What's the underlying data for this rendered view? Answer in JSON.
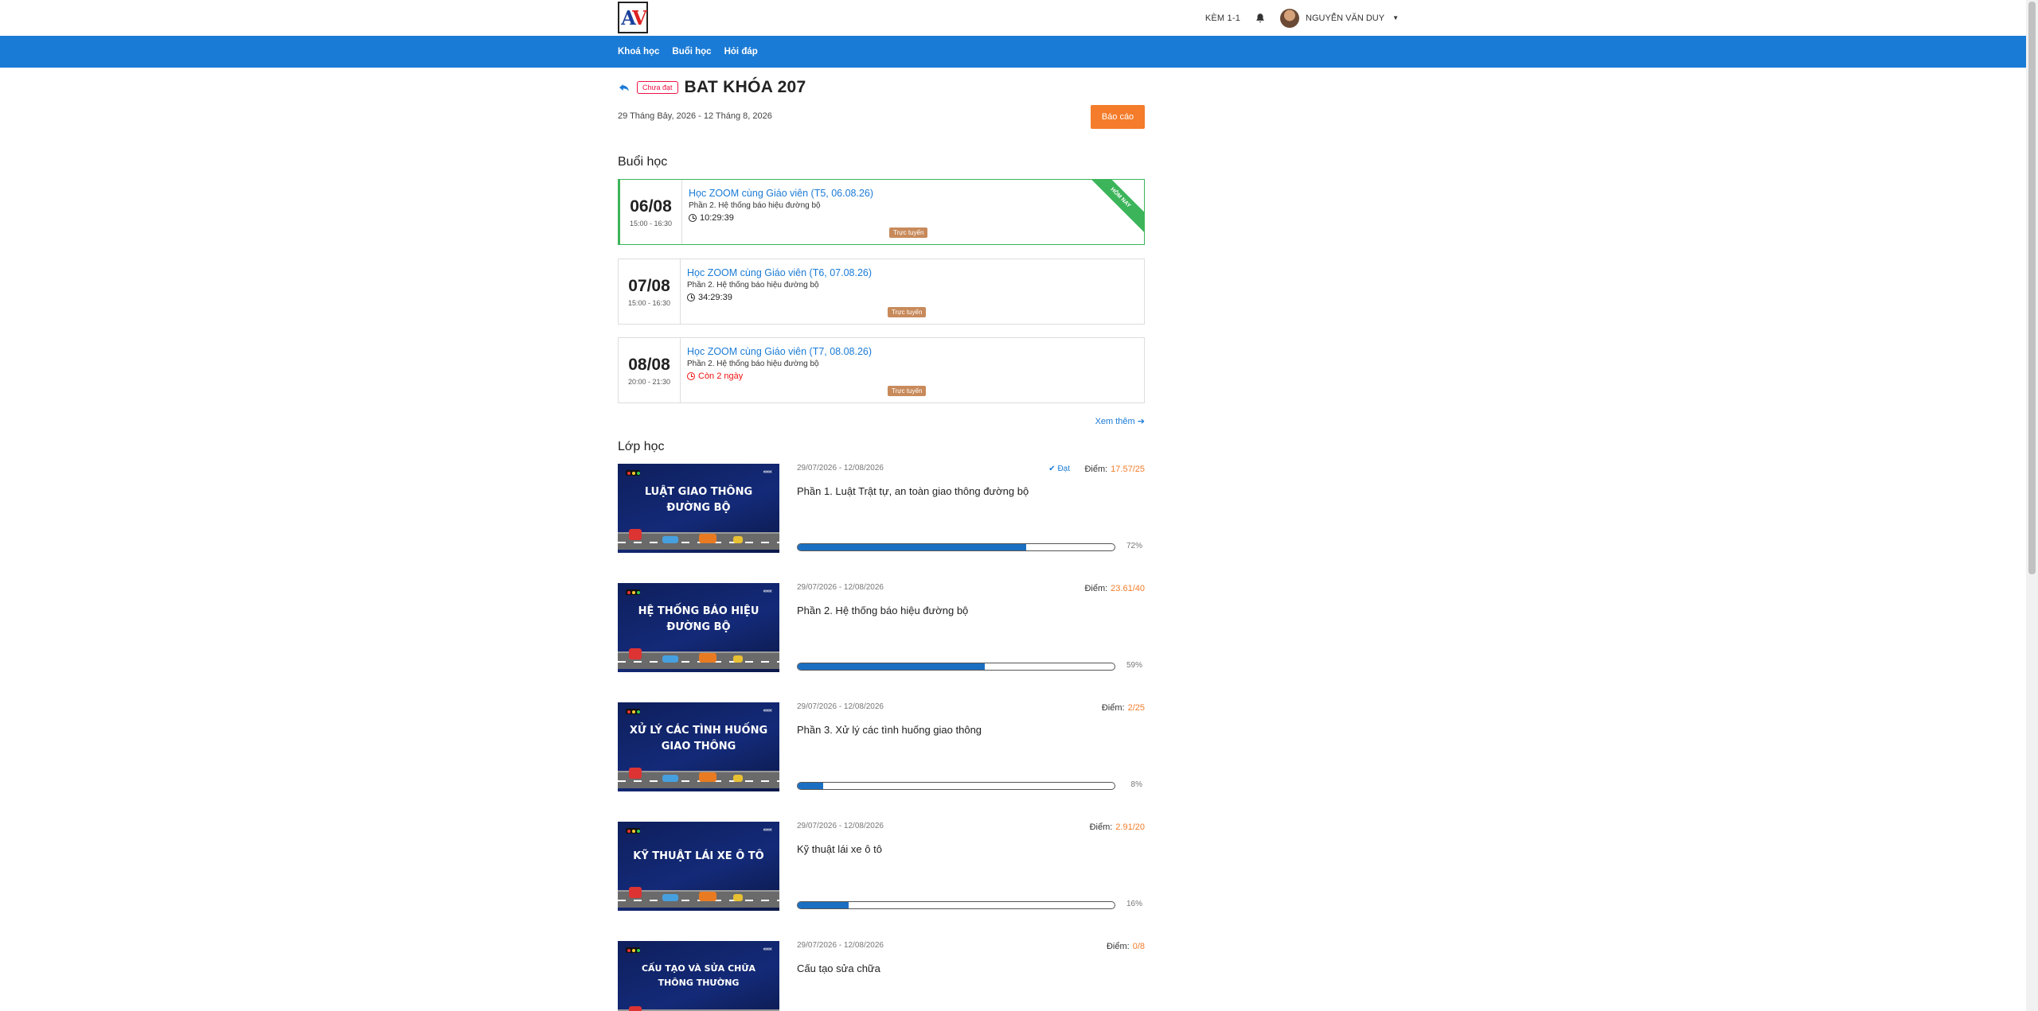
{
  "header": {
    "tutor_label": "KÈM 1-1",
    "user_name": "NGUYỄN VĂN DUY"
  },
  "nav": {
    "items": [
      "Khoá học",
      "Buổi học",
      "Hỏi đáp"
    ]
  },
  "course": {
    "status": "Chưa đạt",
    "title": "BAT KHÓA 207",
    "date_range": "29 Tháng Bảy, 2026 - 12 Tháng 8, 2026",
    "report_label": "Báo cáo"
  },
  "sessions_section": {
    "title": "Buổi học",
    "see_more": "Xem thêm",
    "items": [
      {
        "day": "06/08",
        "time": "15:00 - 16:30",
        "name": "Học ZOOM cùng Giáo viên (T5, 06.08.26)",
        "sub": "Phần 2. Hệ thống báo hiệu đường bộ",
        "countdown": "10:29:39",
        "badge": "Trực tuyến",
        "ribbon": "HÔM NAY"
      },
      {
        "day": "07/08",
        "time": "15:00 - 16:30",
        "name": "Học ZOOM cùng Giáo viên (T6, 07.08.26)",
        "sub": "Phần 2. Hệ thống báo hiệu đường bộ",
        "countdown": "34:29:39",
        "badge": "Trực tuyến"
      },
      {
        "day": "08/08",
        "time": "20:00 - 21:30",
        "name": "Học ZOOM cùng Giáo viên (T7, 08.08.26)",
        "sub": "Phần 2. Hệ thống báo hiệu đường bộ",
        "countdown": "Còn 2 ngày",
        "badge": "Trực tuyến"
      }
    ]
  },
  "classes_section": {
    "title": "Lớp học",
    "score_label": "Điểm:",
    "items": [
      {
        "thumb_title": "Luật giao thông đường bộ",
        "dates": "29/07/2026 - 12/08/2026",
        "name": "Phần 1. Luật Trật tự, an toàn giao thông đường bộ",
        "pass": "Đạt",
        "score": "17.57/25",
        "progress": 72,
        "progress_label": "72%"
      },
      {
        "thumb_title": "Hệ thống báo hiệu đường bộ",
        "dates": "29/07/2026 - 12/08/2026",
        "name": "Phần 2. Hệ thống báo hiệu đường bộ",
        "score": "23.61/40",
        "progress": 59,
        "progress_label": "59%"
      },
      {
        "thumb_title": "Xử lý các tình huống giao thông",
        "dates": "29/07/2026 - 12/08/2026",
        "name": "Phần 3. Xử lý các tình huống giao thông",
        "score": "2/25",
        "progress": 8,
        "progress_label": "8%"
      },
      {
        "thumb_title": "Kỹ thuật lái xe ô tô",
        "dates": "29/07/2026 - 12/08/2026",
        "name": "Kỹ thuật lái xe ô tô",
        "score": "2.91/20",
        "progress": 16,
        "progress_label": "16%"
      },
      {
        "thumb_title": "Cấu tạo và sửa chữa thông thường",
        "dates": "29/07/2026 - 12/08/2026",
        "name": "Cấu tạo sửa chữa",
        "score": "0/8"
      }
    ]
  }
}
